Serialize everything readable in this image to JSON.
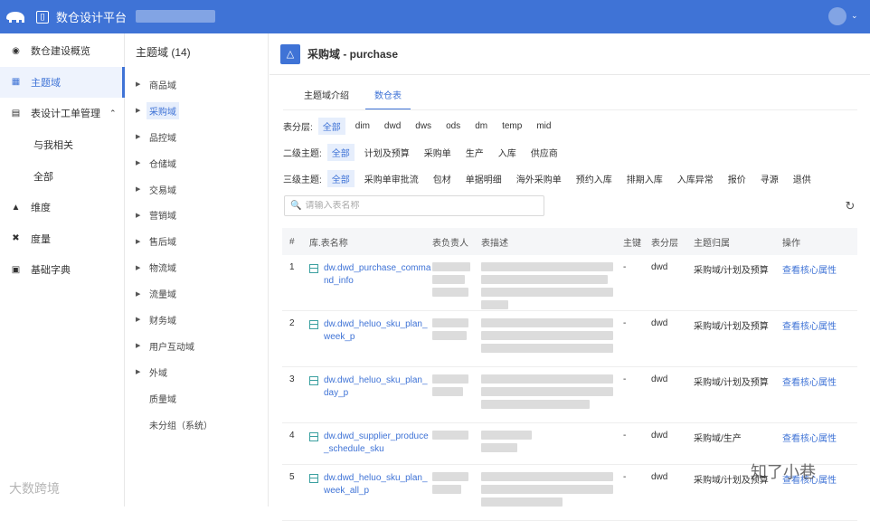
{
  "app": {
    "title": "数仓设计平台"
  },
  "leftnav": {
    "items": [
      {
        "label": "数仓建设概览",
        "icon": "dashboard-icon",
        "active": false
      },
      {
        "label": "主题域",
        "icon": "grid-icon",
        "active": true
      },
      {
        "label": "表设计工单管理",
        "icon": "table-icon",
        "active": false,
        "expanded": true
      },
      {
        "label": "与我相关",
        "sub": true
      },
      {
        "label": "全部",
        "sub": true
      },
      {
        "label": "维度",
        "icon": "dimension-icon"
      },
      {
        "label": "度量",
        "icon": "measure-icon"
      },
      {
        "label": "基础字典",
        "icon": "dictionary-icon"
      }
    ]
  },
  "tree": {
    "title": "主题域 (14)",
    "items": [
      {
        "label": "商品域"
      },
      {
        "label": "采购域",
        "active": true
      },
      {
        "label": "品控域"
      },
      {
        "label": "仓储域"
      },
      {
        "label": "交易域"
      },
      {
        "label": "营销域"
      },
      {
        "label": "售后域"
      },
      {
        "label": "物流域"
      },
      {
        "label": "流量域"
      },
      {
        "label": "财务域"
      },
      {
        "label": "用户互动域"
      },
      {
        "label": "外域"
      },
      {
        "label": "质量域",
        "noarrow": true
      },
      {
        "label": "未分组（系统）",
        "noarrow": true
      }
    ]
  },
  "main": {
    "title": "采购域 - purchase",
    "tabs": [
      {
        "label": "主题域介绍",
        "active": false
      },
      {
        "label": "数仓表",
        "active": true
      }
    ],
    "filters": {
      "layer": {
        "label": "表分层:",
        "options": [
          "全部",
          "dim",
          "dwd",
          "dws",
          "ods",
          "dm",
          "temp",
          "mid"
        ]
      },
      "second": {
        "label": "二级主题:",
        "options": [
          "全部",
          "计划及预算",
          "采购单",
          "生产",
          "入库",
          "供应商"
        ]
      },
      "third": {
        "label": "三级主题:",
        "options": [
          "全部",
          "采购单审批流",
          "包材",
          "单据明细",
          "海外采购单",
          "预约入库",
          "排期入库",
          "入库异常",
          "报价",
          "寻源",
          "退供"
        ]
      }
    },
    "search": {
      "placeholder": "请输入表名称"
    },
    "table": {
      "headers": [
        "#",
        "库.表名称",
        "表负责人",
        "表描述",
        "主键",
        "表分层",
        "主题归属",
        "操作"
      ],
      "rows": [
        {
          "no": "1",
          "name": "dw.dwd_purchase_command_info",
          "pk": "-",
          "layer": "dwd",
          "theme": "采购域/计划及预算",
          "op": "查看核心属性"
        },
        {
          "no": "2",
          "name": "dw.dwd_heluo_sku_plan_week_p",
          "pk": "-",
          "layer": "dwd",
          "theme": "采购域/计划及预算",
          "op": "查看核心属性"
        },
        {
          "no": "3",
          "name": "dw.dwd_heluo_sku_plan_day_p",
          "pk": "-",
          "layer": "dwd",
          "theme": "采购域/计划及预算",
          "op": "查看核心属性"
        },
        {
          "no": "4",
          "name": "dw.dwd_supplier_produce_schedule_sku",
          "pk": "-",
          "layer": "dwd",
          "theme": "采购域/生产",
          "op": "查看核心属性"
        },
        {
          "no": "5",
          "name": "dw.dwd_heluo_sku_plan_week_all_p",
          "pk": "-",
          "layer": "dwd",
          "theme": "采购域/计划及预算",
          "op": "查看核心属性"
        }
      ]
    }
  },
  "watermarks": {
    "left": "大数跨境",
    "right": "知了小巷"
  },
  "colors": {
    "primary": "#3f73d6",
    "active_bg": "#e6eefc"
  }
}
